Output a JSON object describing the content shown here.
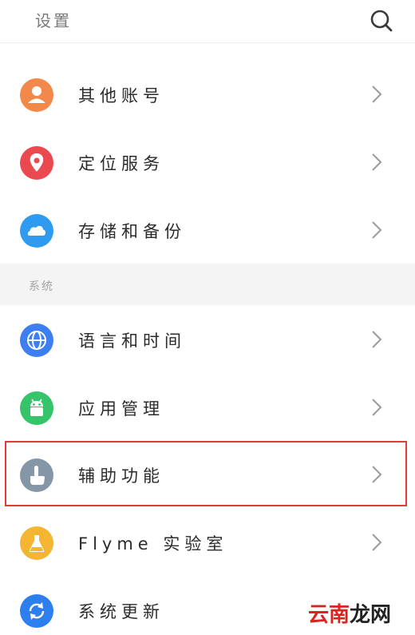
{
  "header": {
    "title": "设置",
    "search_icon": "search-icon"
  },
  "rows_top": [
    {
      "label": "其他账号",
      "icon": "person-icon",
      "color": "#f2894a"
    },
    {
      "label": "定位服务",
      "icon": "location-pin-icon",
      "color": "#ea4a4f"
    },
    {
      "label": "存储和备份",
      "icon": "cloud-icon",
      "color": "#2f9bf0"
    }
  ],
  "section": {
    "title": "系统"
  },
  "rows_system": [
    {
      "label": "语言和时间",
      "icon": "globe-icon",
      "color": "#3d7ff0"
    },
    {
      "label": "应用管理",
      "icon": "android-icon",
      "color": "#35c46a"
    },
    {
      "label": "辅助功能",
      "icon": "hand-pointer-icon",
      "color": "#8596a6",
      "highlighted": true
    },
    {
      "label": "Flyme 实验室",
      "icon": "flask-icon",
      "color": "#f4b532"
    },
    {
      "label": "系统更新",
      "icon": "refresh-icon",
      "color": "#2d7ff0"
    }
  ],
  "watermark": {
    "part1": "云南",
    "part2": "龙网"
  },
  "colors": {
    "highlight_border": "#e23b3b",
    "chevron": "#9a9a9a",
    "section_bg": "#f4f4f4"
  }
}
